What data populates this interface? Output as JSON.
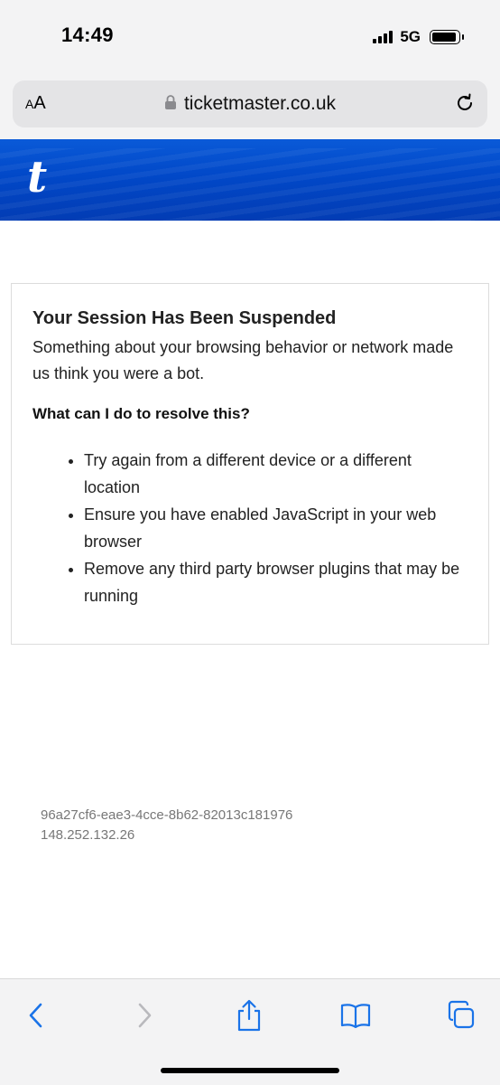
{
  "status_bar": {
    "time": "14:49",
    "network": "5G"
  },
  "browser": {
    "text_size_label_big": "A",
    "text_size_label_small": "A",
    "url": "ticketmaster.co.uk"
  },
  "brand": {
    "logo_letter": "t",
    "accent": "#0148c8"
  },
  "notice": {
    "title": "Your Session Has Been Suspended",
    "description": "Something about your browsing behavior or network made us think you were a bot.",
    "subtitle": "What can I do to resolve this?",
    "items": [
      "Try again from a different device or a different location",
      "Ensure you have enabled JavaScript in your web browser",
      "Remove any third party browser plugins that may be running"
    ]
  },
  "footer": {
    "request_id": "96a27cf6-eae3-4cce-8b62-82013c181976",
    "ip_address": "148.252.132.26"
  },
  "toolbar": {
    "icons": [
      "back-icon",
      "forward-icon",
      "share-icon",
      "bookmarks-icon",
      "tabs-icon"
    ],
    "icon_color": "#1a73e8"
  }
}
